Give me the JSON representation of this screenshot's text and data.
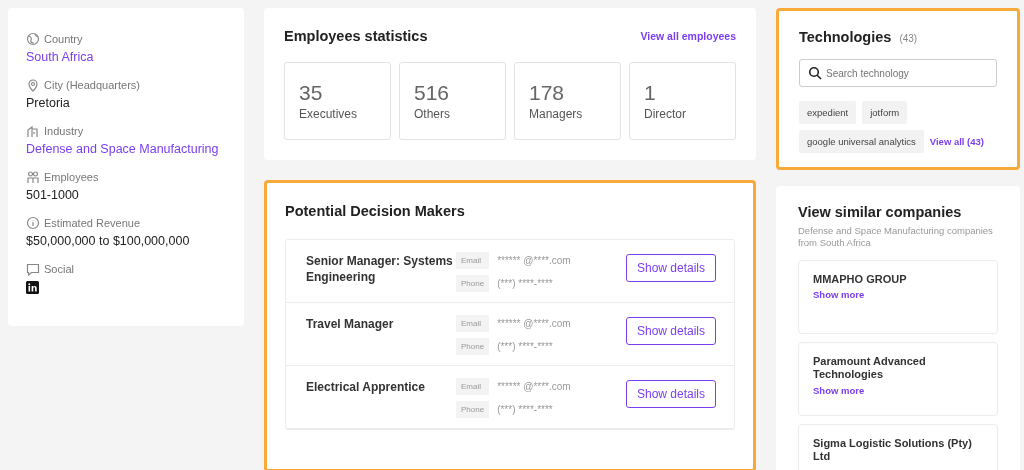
{
  "company_info": {
    "fields": [
      {
        "label": "Country",
        "value": "South Africa",
        "kind": "link"
      },
      {
        "label": "City (Headquarters)",
        "value": "Pretoria",
        "kind": "text"
      },
      {
        "label": "Industry",
        "value": "Defense and Space Manufacturing",
        "kind": "link"
      },
      {
        "label": "Employees",
        "value": "501-1000",
        "kind": "text"
      },
      {
        "label": "Estimated Revenue",
        "value": "$50,000,000 to $100,000,000",
        "kind": "text"
      },
      {
        "label": "Social",
        "kind": "social"
      }
    ]
  },
  "employees_statistics": {
    "title": "Employees statistics",
    "link": "View all employees",
    "stats": [
      {
        "count": "35",
        "label": "Executives"
      },
      {
        "count": "516",
        "label": "Others"
      },
      {
        "count": "178",
        "label": "Managers"
      },
      {
        "count": "1",
        "label": "Director"
      }
    ]
  },
  "decision_makers": {
    "title": "Potential Decision Makers",
    "highlighted": true,
    "people": [
      {
        "title": "Senior Manager: Systems Engineering",
        "email_label": "Email",
        "email": "****** @****.com",
        "phone_label": "Phone",
        "phone": "(***) ****-****",
        "button": "Show details"
      },
      {
        "title": "Travel Manager",
        "email_label": "Email",
        "email": "****** @****.com",
        "phone_label": "Phone",
        "phone": "(***) ****-****",
        "button": "Show details"
      },
      {
        "title": "Electrical Apprentice",
        "email_label": "Email",
        "email": "****** @****.com",
        "phone_label": "Phone",
        "phone": "(***) ****-****",
        "button": "Show details"
      }
    ]
  },
  "technologies": {
    "title": "Technologies",
    "count": "(43)",
    "highlighted": true,
    "search": {
      "placeholder": "Search technology"
    },
    "tags": [
      "expedient",
      "jotform",
      "google universal analytics"
    ],
    "view_all": "View all (43)"
  },
  "similar_companies": {
    "title": "View similar companies",
    "subtitle": "Defense and Space Manufacturing companies from South Africa",
    "companies": [
      {
        "name": "MMAPHO GROUP",
        "link": "Show more"
      },
      {
        "name": "Paramount Advanced Technologies",
        "link": "Show more"
      },
      {
        "name": "Sigma Logistic Solutions (Pty) Ltd"
      }
    ]
  }
}
